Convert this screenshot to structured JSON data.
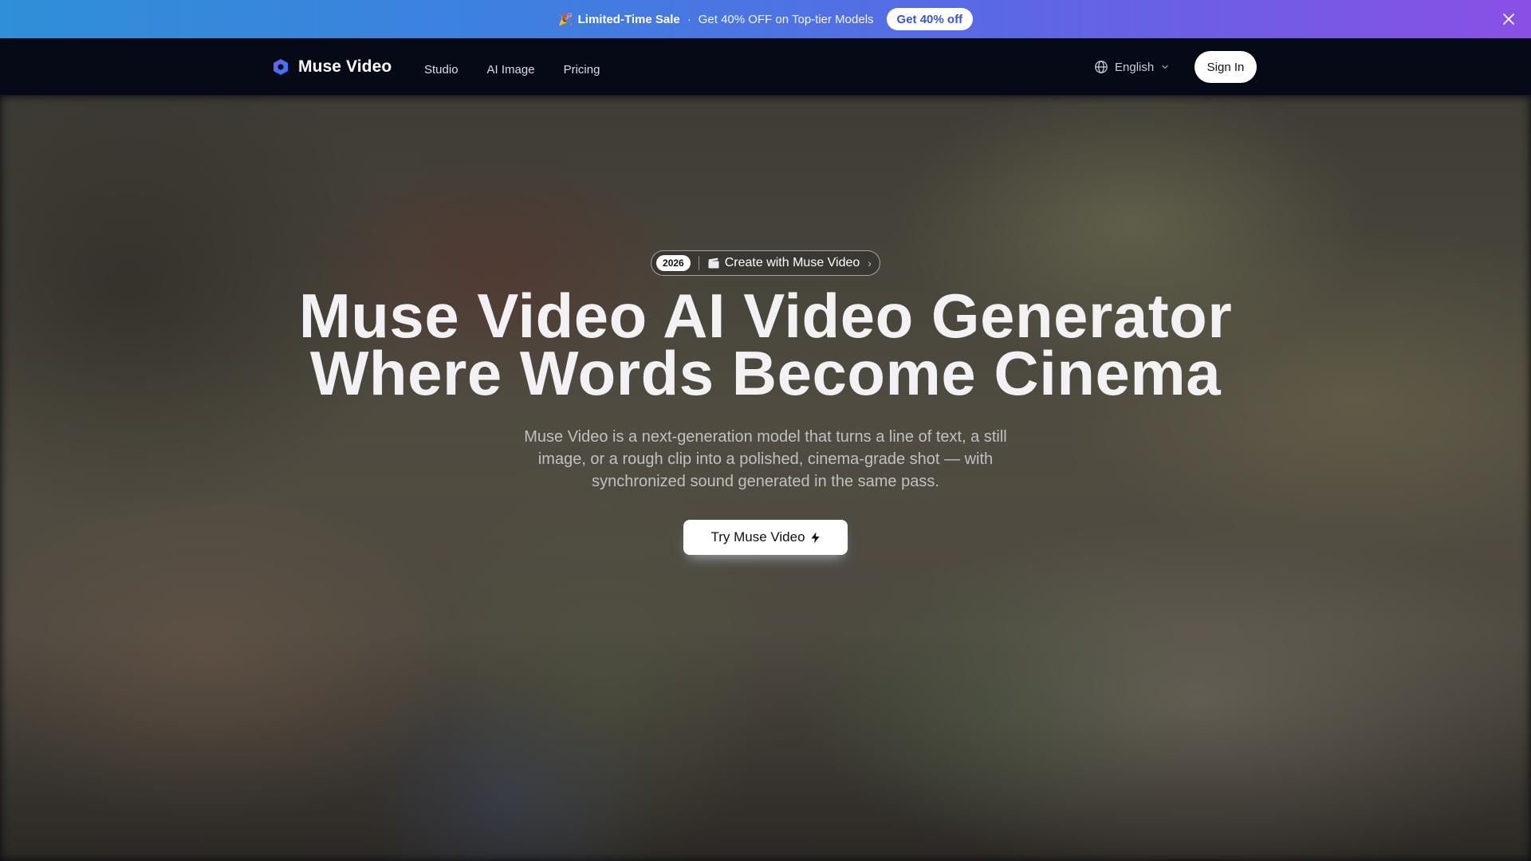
{
  "promo": {
    "emoji": "🎉",
    "title": "Limited-Time Sale",
    "separator": "·",
    "offer": "Get 40% OFF on Top-tier Models",
    "cta": "Get 40% off"
  },
  "header": {
    "brand": "Muse Video",
    "nav": [
      "Studio",
      "AI Image",
      "Pricing"
    ],
    "language": "English",
    "sign_in": "Sign In"
  },
  "hero": {
    "badge_year": "2026",
    "badge_label": "Create with Muse Video",
    "title_line1": "Muse Video AI Video Generator",
    "title_line2": "Where Words Become Cinema",
    "subtitle": "Muse Video is a next-generation model that turns a line of text, a still image, or a rough clip into a polished, cinema-grade shot — with synchronized sound generated in the same pass.",
    "cta": "Try Muse Video"
  },
  "colors": {
    "banner_start": "#2f8fd8",
    "banner_end": "#8a4fe6",
    "header_bg": "#060a17",
    "accent": "#4f5bff"
  }
}
